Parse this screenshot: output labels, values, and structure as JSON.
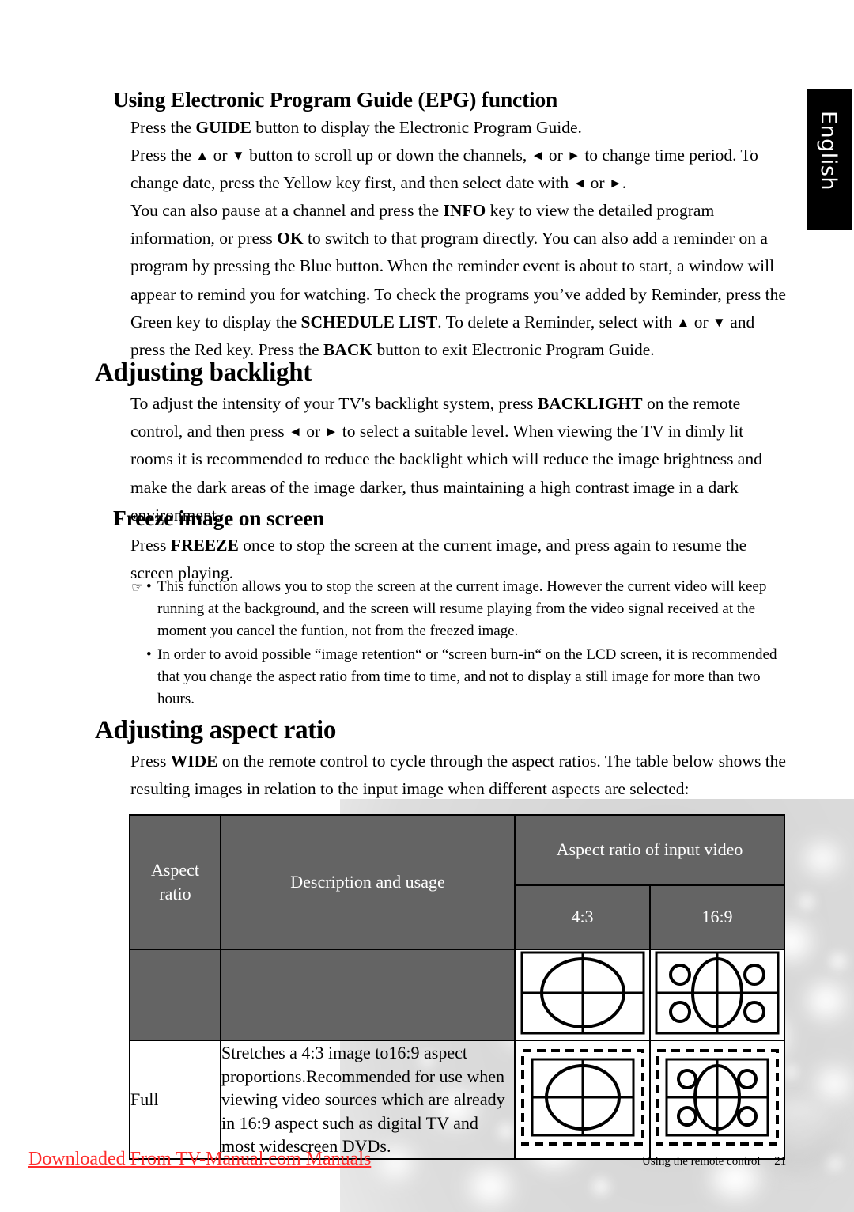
{
  "side_tab": {
    "label": "English"
  },
  "sections": [
    {
      "id": "epg",
      "heading": "Using Electronic Program Guide (EPG) function",
      "heading_level": "sub",
      "paragraphs": [
        "Press the GUIDE button to display the Electronic Program Guide.",
        "Press the ▲ or ▼ button to scroll up or down the channels, ◄ or ► to change time period. To change date, press the Yellow key first, and then select date with ◄ or ►.",
        "You can also pause at a channel and press the INFO key to view the detailed program information, or press OK to switch to that program directly. You can also add a reminder on a program by pressing the Blue button. When the reminder event is about to start, a window will appear to remind you for watching. To check the programs you’ve added by Reminder, press the Green key to display the SCHEDULE LIST. To delete a Reminder, select with ▲ or ▼ and press the Red key. Press the BACK button to exit Electronic Program Guide."
      ]
    },
    {
      "id": "backlight",
      "heading": "Adjusting backlight",
      "heading_level": "main",
      "paragraphs": [
        "To adjust the intensity of your TV's backlight system, press BACKLIGHT on the remote control, and then press ◄ or ► to select a suitable level. When viewing the TV in dimly lit rooms it is recommended to reduce the backlight which will reduce the image brightness and make the dark areas of the image darker, thus maintaining a high contrast image in a dark environment."
      ]
    },
    {
      "id": "freeze",
      "heading": "Freeze image on screen",
      "heading_level": "sub",
      "paragraphs": [
        "Press FREEZE once to stop the screen at the current image, and press again to resume the screen playing."
      ],
      "notes": [
        {
          "hand_icon": "☞",
          "bullet": "•",
          "text": "This function allows you to stop the screen at the current image. However the current video will keep running at the background, and the screen will resume playing from the video signal received at the moment you cancel the funtion, not from the freezed image."
        },
        {
          "hand_icon": "",
          "bullet": "•",
          "text": "In order to avoid possible “image retention“ or “screen burn-in“ on the LCD screen, it is recommended that you change the aspect ratio from time to time, and not to display a still image for more than two hours."
        }
      ]
    },
    {
      "id": "aspect",
      "heading": "Adjusting aspect ratio",
      "heading_level": "main",
      "paragraphs": [
        "Press WIDE on the remote control to cycle through the aspect ratios. The table below shows the resulting images in relation to the input image when different aspects are selected:"
      ]
    }
  ],
  "table": {
    "header_group_label": "Aspect ratio of input video",
    "col_aspect_ratio": "Aspect ratio",
    "col_description": "Description and usage",
    "col_43": "4:3",
    "col_169": "16:9",
    "header_bg": "#646464",
    "header_fg": "#ffffff",
    "rows": [
      {
        "aspect_ratio": "Full",
        "description": "Stretches a 4:3 image to16:9 aspect proportions.Recommended for use when viewing video sources which are already in 16:9 aspect such as digital TV and most widescreen DVDs."
      }
    ]
  },
  "footer": {
    "left_text": "Downloaded From TV-Manual.com Manuals",
    "left_color": "#ff2b2b",
    "right_text": "Using the remote control",
    "page_number": "21"
  }
}
